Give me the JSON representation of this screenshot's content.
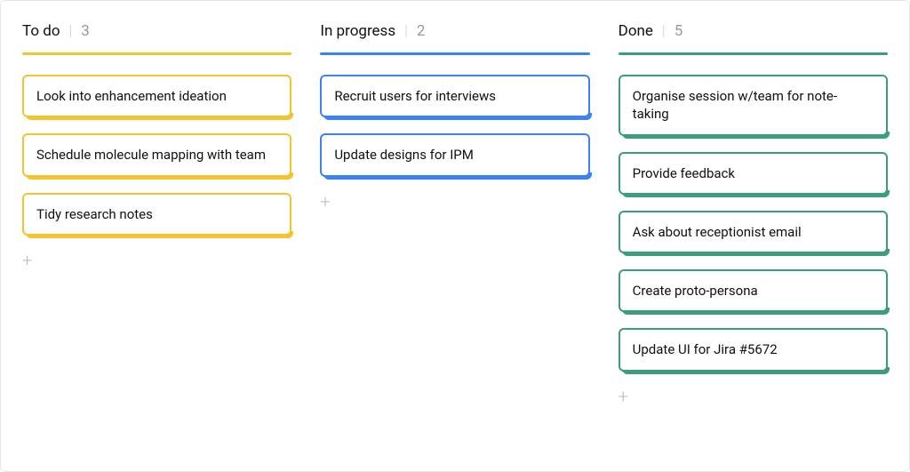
{
  "columns": [
    {
      "id": "todo",
      "title": "To do",
      "count": "3",
      "color": "yellow",
      "cards": [
        {
          "text": "Look into enhancement ideation"
        },
        {
          "text": "Schedule molecule mapping with team"
        },
        {
          "text": "Tidy research notes"
        }
      ]
    },
    {
      "id": "in-progress",
      "title": "In progress",
      "count": "2",
      "color": "blue",
      "cards": [
        {
          "text": "Recruit users for interviews"
        },
        {
          "text": "Update designs for IPM"
        }
      ]
    },
    {
      "id": "done",
      "title": "Done",
      "count": "5",
      "color": "green",
      "cards": [
        {
          "text": "Organise session w/team for note-taking"
        },
        {
          "text": "Provide feedback"
        },
        {
          "text": "Ask about receptionist email"
        },
        {
          "text": "Create proto-persona"
        },
        {
          "text": "Update UI for Jira #5672"
        }
      ]
    }
  ],
  "separator": "|",
  "add_label": "+"
}
